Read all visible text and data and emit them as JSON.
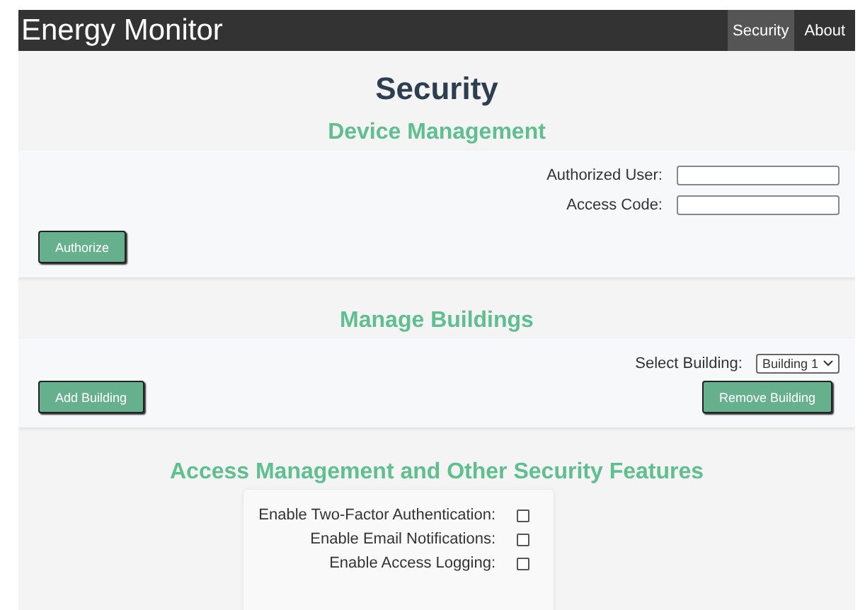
{
  "header": {
    "title": "Energy Monitor",
    "nav": [
      {
        "label": "Security",
        "selected": true
      },
      {
        "label": "About",
        "selected": false
      }
    ]
  },
  "page_title": "Security",
  "device_management": {
    "heading": "Device Management",
    "fields": [
      {
        "label": "Authorized User:"
      },
      {
        "label": "Access Code:"
      }
    ],
    "button": "Authorize"
  },
  "manage_buildings": {
    "heading": "Manage Buildings",
    "select_label": "Select Building:",
    "select_value": "Building 1",
    "buttons": [
      "Add Building",
      "Remove Building"
    ]
  },
  "access_management": {
    "heading": "Access Management and Other Security Features",
    "options": [
      {
        "label": "Enable Two-Factor Authentication:",
        "checked": false
      },
      {
        "label": "Enable Email Notifications:",
        "checked": false
      },
      {
        "label": "Enable Access Logging:",
        "checked": false
      }
    ]
  }
}
